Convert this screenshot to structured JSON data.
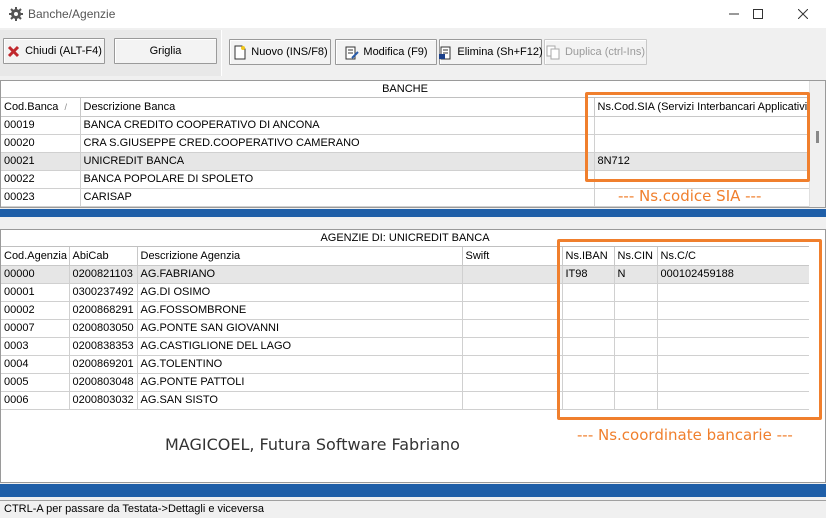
{
  "window": {
    "title": "Banche/Agenzie"
  },
  "toolbar": {
    "close_label": "Chiudi (ALT-F4)",
    "grid_label": "Griglia",
    "new_label": "Nuovo (INS/F8)",
    "edit_label": "Modifica (F9)",
    "delete_label": "Elimina (Sh+F12)",
    "duplicate_label": "Duplica (ctrl-Ins)"
  },
  "banche": {
    "title": "BANCHE",
    "columns": [
      "Cod.Banca",
      "Descrizione Banca",
      "Ns.Cod.SIA (Servizi Interbancari Applicativi)"
    ],
    "rows": [
      {
        "cod": "00019",
        "descr": "BANCA CREDITO COOPERATIVO DI ANCONA",
        "sia": ""
      },
      {
        "cod": "00020",
        "descr": "CRA S.GIUSEPPE CRED.COOPERATIVO CAMERANO",
        "sia": ""
      },
      {
        "cod": "00021",
        "descr": "UNICREDIT BANCA",
        "sia": "8N712"
      },
      {
        "cod": "00022",
        "descr": "BANCA POPOLARE DI SPOLETO",
        "sia": ""
      },
      {
        "cod": "00023",
        "descr": "CARISAP",
        "sia": ""
      }
    ],
    "annotation": "--- Ns.codice SIA ---"
  },
  "agenzie": {
    "title": "AGENZIE DI: UNICREDIT BANCA",
    "columns": [
      "Cod.Agenzia",
      "AbiCab",
      "Descrizione Agenzia",
      "Swift",
      "Ns.IBAN",
      "Ns.CIN",
      "Ns.C/C"
    ],
    "rows": [
      {
        "cod": "00000",
        "abicab": "0200821103",
        "descr": "AG.FABRIANO",
        "swift": "",
        "iban": "IT98",
        "cin": "N",
        "cc": "000102459188"
      },
      {
        "cod": "00001",
        "abicab": "0300237492",
        "descr": "AG.DI OSIMO",
        "swift": "",
        "iban": "",
        "cin": "",
        "cc": ""
      },
      {
        "cod": "00002",
        "abicab": "0200868291",
        "descr": "AG.FOSSOMBRONE",
        "swift": "",
        "iban": "",
        "cin": "",
        "cc": ""
      },
      {
        "cod": "00007",
        "abicab": "0200803050",
        "descr": "AG.PONTE SAN GIOVANNI",
        "swift": "",
        "iban": "",
        "cin": "",
        "cc": ""
      },
      {
        "cod": "0003",
        "abicab": "0200838353",
        "descr": "AG.CASTIGLIONE DEL LAGO",
        "swift": "",
        "iban": "",
        "cin": "",
        "cc": ""
      },
      {
        "cod": "0004",
        "abicab": "0200869201",
        "descr": "AG.TOLENTINO",
        "swift": "",
        "iban": "",
        "cin": "",
        "cc": ""
      },
      {
        "cod": "0005",
        "abicab": "0200803048",
        "descr": "AG.PONTE PATTOLI",
        "swift": "",
        "iban": "",
        "cin": "",
        "cc": ""
      },
      {
        "cod": "0006",
        "abicab": "0200803032",
        "descr": "AG.SAN SISTO",
        "swift": "",
        "iban": "",
        "cin": "",
        "cc": ""
      }
    ],
    "annotation": "--- Ns.coordinate bancarie ---",
    "watermark": "MAGICOEL, Futura Software Fabriano"
  },
  "status": {
    "text": "CTRL-A per passare da Testata->Dettagli e viceversa"
  },
  "colors": {
    "highlight": "#f07f2d",
    "divider": "#1f5fa8"
  }
}
